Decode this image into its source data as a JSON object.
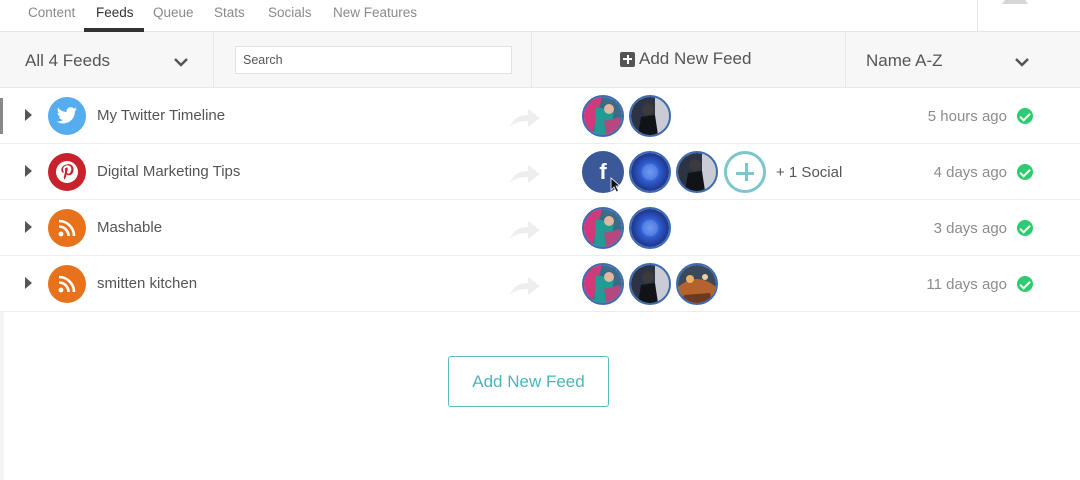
{
  "nav": {
    "tabs": [
      {
        "label": "Content",
        "active": false
      },
      {
        "label": "Feeds",
        "active": true
      },
      {
        "label": "Queue",
        "active": false
      },
      {
        "label": "Stats",
        "active": false
      },
      {
        "label": "Socials",
        "active": false
      },
      {
        "label": "New Features",
        "active": false
      }
    ],
    "notification_icon": "bell-icon"
  },
  "toolbar": {
    "feed_filter": "All 4 Feeds",
    "search_placeholder": "Search",
    "add_feed_label": "Add New Feed",
    "sort_label": "Name A-Z"
  },
  "feeds": [
    {
      "name": "My Twitter Timeline",
      "type": "twitter",
      "icon": "twitter-icon",
      "color": "#55acee",
      "socials": [
        "avatar",
        "avatar"
      ],
      "extra_socials": "",
      "time": "5 hours ago",
      "status": "ok"
    },
    {
      "name": "Digital Marketing Tips",
      "type": "pinterest",
      "icon": "pinterest-icon",
      "color": "#c8232c",
      "socials": [
        "facebook",
        "avatar",
        "avatar"
      ],
      "add_social": true,
      "extra_socials": "+ 1 Social",
      "time": "4 days ago",
      "status": "ok"
    },
    {
      "name": "Mashable",
      "type": "rss",
      "icon": "rss-icon",
      "color": "#e8711c",
      "socials": [
        "avatar",
        "avatar"
      ],
      "extra_socials": "",
      "time": "3 days ago",
      "status": "ok"
    },
    {
      "name": "smitten kitchen",
      "type": "rss",
      "icon": "rss-icon",
      "color": "#e8711c",
      "socials": [
        "avatar",
        "avatar",
        "avatar"
      ],
      "extra_socials": "",
      "time": "11 days ago",
      "status": "ok"
    }
  ],
  "facebook_letter": "f",
  "footer": {
    "add_feed_button": "Add New Feed"
  },
  "colors": {
    "accent": "#4fb3ba",
    "success": "#2ecc71",
    "facebook": "#3b5998"
  }
}
